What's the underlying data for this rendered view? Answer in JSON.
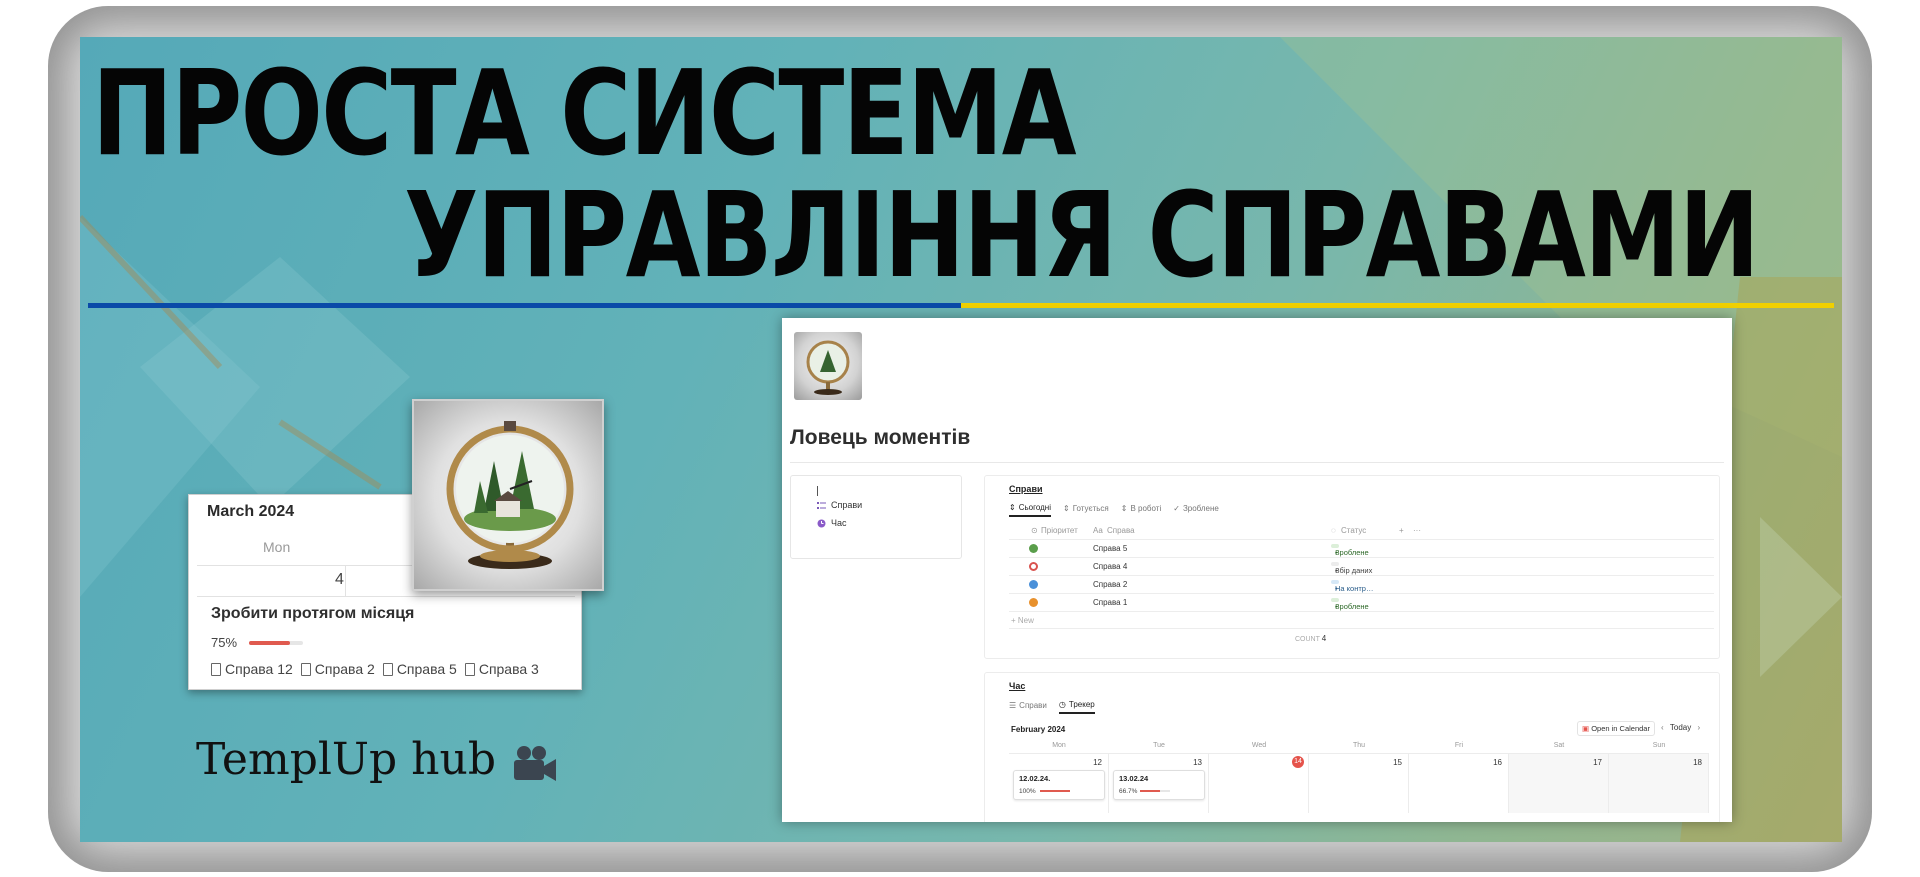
{
  "banner": {
    "title_line1": "ПРОСТА СИСТЕМА",
    "title_line2": "УПРАВЛІННЯ СПРАВАМИ",
    "brand": "TemplUp hub"
  },
  "calendar_card": {
    "month": "March 2024",
    "weekday": "Mon",
    "day": "4",
    "task_title": "Зробити протягом місяця",
    "progress_label": "75%",
    "progress": 0.75,
    "linked_pages": [
      "Справа 12",
      "Справа 2",
      "Справа 5",
      "Справа 3"
    ]
  },
  "notion": {
    "page_title": "Ловець моментів",
    "nav": {
      "items": [
        "Справи",
        "Час"
      ]
    },
    "tasks_block": {
      "heading": "Справи",
      "tabs": [
        "Сьогодні",
        "Готується",
        "В роботі",
        "Зроблене"
      ],
      "columns": {
        "priority": "Пріоритет",
        "name": "Справа",
        "status": "Статус",
        "add": "+",
        "more": "···"
      },
      "rows": [
        {
          "name": "Справа 5",
          "status": "Зроблене",
          "dot": "#5a9e4b",
          "tag_bg": "#dcefd9",
          "tag_fg": "#2f6a2a"
        },
        {
          "name": "Справа 4",
          "status": "Збір даних",
          "dot": "#d9534f",
          "tag_bg": "#ececec",
          "tag_fg": "#444444"
        },
        {
          "name": "Справа 2",
          "status": "На контр…",
          "dot": "#4a90d9",
          "tag_bg": "#d6e8f7",
          "tag_fg": "#2a5d8a"
        },
        {
          "name": "Справа 1",
          "status": "Зроблене",
          "dot": "#e8912d",
          "tag_bg": "#dcefd9",
          "tag_fg": "#2f6a2a"
        }
      ],
      "new_label": "+ New",
      "count_label": "COUNT",
      "count_value": "4"
    },
    "time_block": {
      "heading": "Час",
      "tabs": [
        "Справи",
        "Трекер"
      ],
      "month": "February 2024",
      "open_calendar": "Open in Calendar",
      "today": "Today",
      "weekdays": [
        "Mon",
        "Tue",
        "Wed",
        "Thu",
        "Fri",
        "Sat",
        "Sun"
      ],
      "days": [
        "12",
        "13",
        "14",
        "15",
        "16",
        "17",
        "18"
      ],
      "today_index": 2,
      "events": [
        {
          "title": "12.02.24.",
          "pct_label": "100%",
          "progress": 1.0
        },
        {
          "title": "13.02.24",
          "pct_label": "66.7%",
          "progress": 0.667
        }
      ]
    }
  },
  "colors": {
    "flag_blue": "#0a4aa8",
    "flag_yellow": "#f0d000",
    "progress_red": "#e05a4f",
    "today_red": "#e5534b"
  }
}
